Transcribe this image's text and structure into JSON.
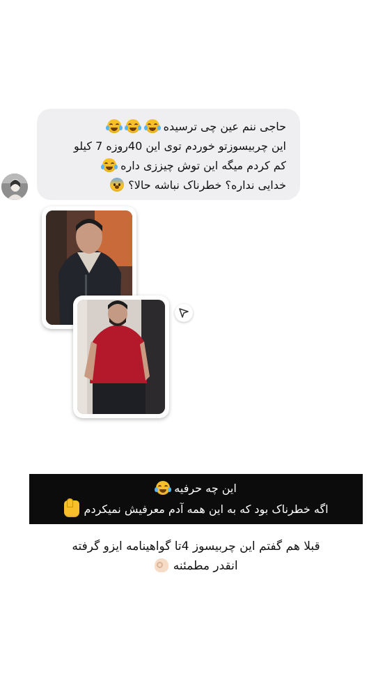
{
  "chat": {
    "avatar_icon": "profile-avatar",
    "message": {
      "line1": "حاجی ننم عین چی ترسیده",
      "line2": "این چربیسوزتو خوردم توی این 40روزه 7 کیلو",
      "line3": "کم کردم میگه این توش چیززی داره",
      "line4": "خدایی نداره؟ خطرناک نباشه حالا؟"
    },
    "share_icon": "send-arrow-icon"
  },
  "caption": {
    "line1": "این چه حرفیه",
    "line2": "اگه خطرناک بود که به این همه آدم معرفیش نمیکردم"
  },
  "bottom": {
    "line1": "قبلا هم گفتم این چربیسوز 4تا گواهینامه ایزو گرفته",
    "line2": "انقدر مطمئنه"
  },
  "colors": {
    "bubble_bg": "#efeff2",
    "caption_bg": "#0c0c0c",
    "caption_text": "#ffffff"
  }
}
